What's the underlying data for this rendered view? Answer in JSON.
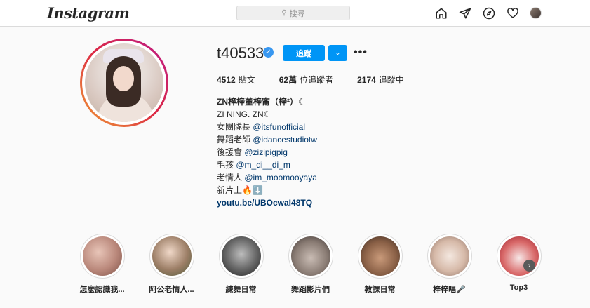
{
  "header": {
    "logo_text": "Instagram",
    "search_placeholder": "搜尋",
    "icons": [
      "home-icon",
      "direct-icon",
      "explore-icon",
      "heart-icon",
      "profile-avatar"
    ]
  },
  "profile": {
    "username": "t40533",
    "verified": true,
    "follow_label": "追蹤",
    "stats": {
      "posts_count": "4512",
      "posts_label": "貼文",
      "followers_count": "62萬",
      "followers_label": "位追蹤者",
      "following_count": "2174",
      "following_label": "追蹤中"
    },
    "bio": {
      "full_name": "ZN梓梓董梓甯（梓²）☾",
      "line1": "ZI NING. ZN☾",
      "line2_prefix": "女團隊長 ",
      "line2_mention": "@itsfunofficial",
      "line3_prefix": "舞蹈老師 ",
      "line3_mention": "@idancestudiotw",
      "line4_prefix": "後援會 ",
      "line4_mention": "@zizipigpig",
      "line5_prefix": "毛孩 ",
      "line5_mention": "@m_di__di_m",
      "line6_prefix": "老情人 ",
      "line6_mention": "@im_moomooyaya",
      "line7": "新片上🔥⬇️",
      "website": "youtu.be/UBOcwaI48TQ"
    }
  },
  "highlights": [
    {
      "label": "怎麼認識我..."
    },
    {
      "label": "阿公老情人..."
    },
    {
      "label": "練舞日常"
    },
    {
      "label": "舞蹈影片們"
    },
    {
      "label": "教課日常"
    },
    {
      "label": "梓梓唱🎤"
    },
    {
      "label": "Top3"
    }
  ],
  "colors": {
    "accent": "#0095f6",
    "verified": "#3897f0",
    "link": "#00376b",
    "background": "#fafafa"
  }
}
